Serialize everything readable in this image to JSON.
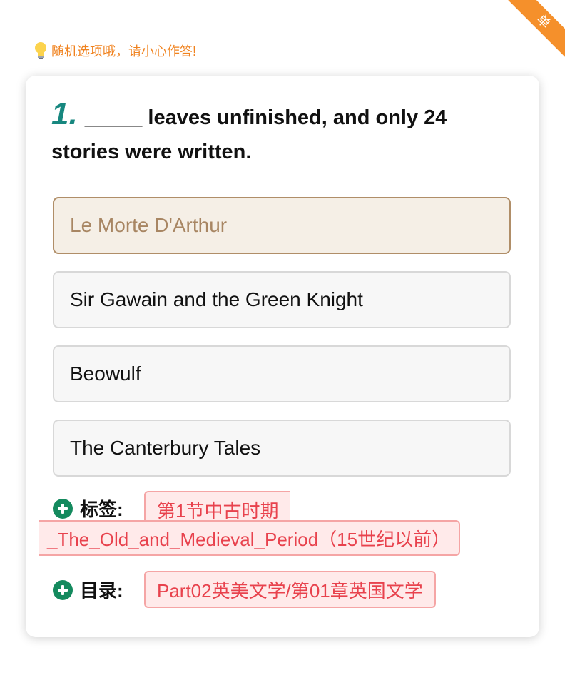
{
  "corner": {
    "label": "单"
  },
  "hint": {
    "text": "随机选项哦，请小心作答!"
  },
  "question": {
    "number": "1.",
    "text": "_____ leaves unfinished, and only 24 stories were written."
  },
  "options": [
    {
      "label": "Le Morte D'Arthur",
      "selected": true
    },
    {
      "label": "Sir Gawain and the Green Knight",
      "selected": false
    },
    {
      "label": "Beowulf",
      "selected": false
    },
    {
      "label": "The Canterbury Tales",
      "selected": false
    }
  ],
  "tags": {
    "label": "标签:",
    "value_line1": "第1节中古时期",
    "value_line2": "_The_Old_and_Medieval_Period（15世纪以前）"
  },
  "catalog": {
    "label": "目录:",
    "value": "Part02英美文学/第01章英国文学"
  },
  "colors": {
    "accent_orange": "#f5902b",
    "question_number": "#17877f",
    "selected_option_bg": "#f5efe6",
    "tag_text": "#e8424d",
    "plus_icon": "#148a5e"
  }
}
